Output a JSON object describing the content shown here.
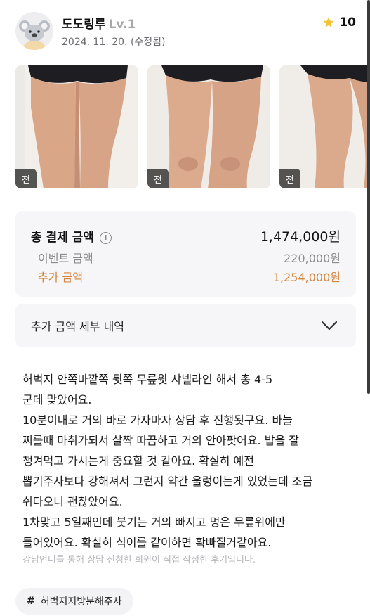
{
  "author": {
    "nickname": "도도링루",
    "level": "Lv.1",
    "date": "2024. 11. 20. (수정됨)",
    "avatar_icon": "koala-icon"
  },
  "rating": {
    "value": "10",
    "icon": "star-icon",
    "color": "#f4c430"
  },
  "photos": [
    {
      "tag": "전"
    },
    {
      "tag": "전"
    },
    {
      "tag": "전"
    }
  ],
  "payment": {
    "total_label": "총 결제 금액",
    "total_value": "1,474,000원",
    "event_label": "이벤트 금액",
    "event_value": "220,000원",
    "extra_label": "추가 금액",
    "extra_value": "1,254,000원",
    "extra_color": "#d4843a"
  },
  "detail": {
    "label": "추가 금액 세부 내역",
    "icon": "chevron-down-icon"
  },
  "review": {
    "text": "허벅지 안쪽바깥쪽 뒷쪽 무릎윗 샤넬라인 해서 총 4-5\n군데 맞았어요.\n10분이내로 거의 바로 가자마자 상담 후 진행됫구요. 바늘\n찌를때 마취가되서 살짝 따끔하고 거의 안아팟어요. 밥을 잘\n챙겨먹고 가시는게 중요할 것 같아요. 확실히 예전\n뽑기주사보다 강해져서 그런지 약간 울렁이는게 있었는데 조금\n쉬다오니 괜찮았어요.\n1차맞고 5일째인데 붓기는 거의 빠지고 멍은 무릎위에만\n들어있어요. 확실히 식이를 같이하면 확빠질거같아요.",
    "notice": "강남언니를 통해 상담 신청한 회원이 직접 작성한 후기입니다."
  },
  "tags": [
    {
      "label": "허벅지지방분해주사"
    }
  ]
}
